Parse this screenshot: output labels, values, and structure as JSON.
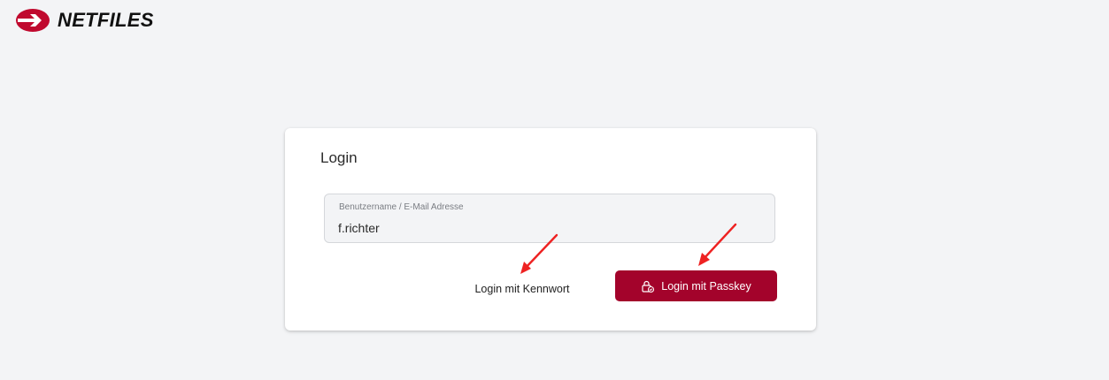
{
  "header": {
    "brand_name": "NETFILES",
    "brand_color": "#c0092e"
  },
  "login": {
    "title": "Login",
    "username_label": "Benutzername / E-Mail Adresse",
    "username_value": "f.richter",
    "password_login_label": "Login mit Kennwort",
    "passkey_login_label": "Login mit Passkey",
    "passkey_icon": "lock-passkey-icon",
    "primary_color": "#a3032b"
  },
  "annotations": {
    "arrow_color": "#ee2222"
  }
}
